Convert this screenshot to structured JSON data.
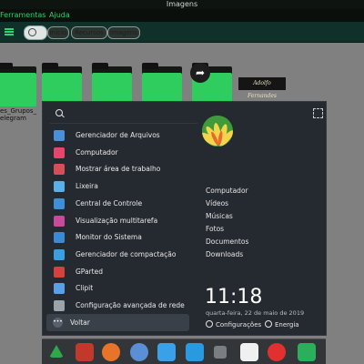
{
  "window": {
    "title": "Imagens"
  },
  "menubar": {
    "items": [
      "Ferramentas",
      "Ajuda"
    ]
  },
  "toolbar": {
    "breadcrumbs": [
      "Inicio",
      "Recursos",
      "Imagens"
    ]
  },
  "desktop": {
    "folder_label_line1": "es_Grupos_",
    "folder_label_line2": "elegram",
    "signature_text": "Adolfo Fernandes"
  },
  "launcher": {
    "apps": [
      {
        "label": "Gerenciador de Arquivos",
        "icon": "file-manager-icon",
        "color": "#4a90d9"
      },
      {
        "label": "Computador",
        "icon": "computer-icon",
        "color": "#e8456a"
      },
      {
        "label": "Mostrar área de trabalho",
        "icon": "desktop-icon",
        "color": "#d84e58"
      },
      {
        "label": "Lixeira",
        "icon": "trash-icon",
        "color": "#5ab0e6"
      },
      {
        "label": "Central de Controle",
        "icon": "control-center-icon",
        "color": "#3f8fd8"
      },
      {
        "label": "Visualização multitarefa",
        "icon": "multitask-icon",
        "color": "#c84a9a"
      },
      {
        "label": "Monitor do Sistema",
        "icon": "system-monitor-icon",
        "color": "#3b8ad6"
      },
      {
        "label": "Gerenciador de compactação",
        "icon": "archive-manager-icon",
        "color": "#3a9ee0"
      },
      {
        "label": "GParted",
        "icon": "gparted-icon",
        "color": "#d64040"
      },
      {
        "label": "Clipit",
        "icon": "clipit-icon",
        "color": "#5aa0e8"
      },
      {
        "label": "Configuração avançada de rede",
        "icon": "network-icon",
        "color": "#9aa2aa"
      }
    ],
    "back_label": "Voltar",
    "places": [
      "Computador",
      "Vídeos",
      "Músicas",
      "Fotos",
      "Documentos",
      "Downloads"
    ],
    "clock": "11:18",
    "date": "quarta-feira, 22 de maio de 2019",
    "settings_label": "Configurações",
    "power_label": "Energia"
  },
  "dock": {
    "items": [
      {
        "icon": "launcher-icon",
        "color": "#2ea84a"
      },
      {
        "icon": "multitask-view-icon",
        "color": "#c0392b"
      },
      {
        "icon": "firefox-icon",
        "color": "#e8742a"
      },
      {
        "icon": "settings-icon",
        "color": "#5a8fd8"
      },
      {
        "icon": "store-icon",
        "color": "#3aa0e8"
      },
      {
        "icon": "folder-icon",
        "color": "#2a9ae0"
      },
      {
        "icon": "more-icon",
        "color": "#7a7e82"
      },
      {
        "icon": "mixer-icon",
        "color": "#f0f0f0"
      },
      {
        "icon": "shutdown-icon",
        "color": "#e03030"
      },
      {
        "icon": "trash-icon",
        "color": "#2ab05a"
      }
    ]
  }
}
